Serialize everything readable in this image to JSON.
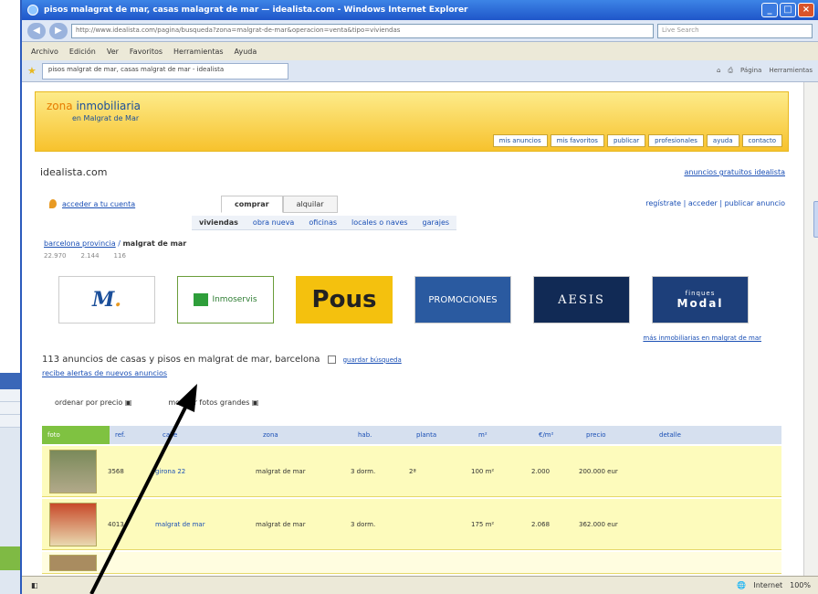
{
  "window": {
    "title": "pisos malagrat de mar, casas malagrat de mar — idealista.com - Windows Internet Explorer",
    "url": "http://www.idealista.com/pagina/busqueda?zona=malgrat-de-mar&operacion=venta&tipo=viviendas",
    "search_placeholder": "Live Search"
  },
  "menu": [
    "Archivo",
    "Edición",
    "Ver",
    "Favoritos",
    "Herramientas",
    "Ayuda"
  ],
  "tab": {
    "label": "pisos malgrat de mar, casas malgrat de mar - idealista"
  },
  "tools": [
    "Página",
    "Herramientas"
  ],
  "banner": {
    "brand_prefix": "zona",
    "brand_name": "inmobiliaria",
    "brand_sub": "en Malgrat de Mar",
    "nav": [
      "mis anuncios",
      "mis favoritos",
      "publicar",
      "profesionales",
      "ayuda",
      "contacto"
    ]
  },
  "site": {
    "name": "idealista.com",
    "top_link": "anuncios gratuitos idealista"
  },
  "user": {
    "link": "acceder a tu cuenta",
    "right_links": "regístrate | acceder | publicar anuncio"
  },
  "modes": {
    "buy": "comprar",
    "rent": "alquilar"
  },
  "subtypes": [
    "viviendas",
    "obra nueva",
    "oficinas",
    "locales o naves",
    "garajes"
  ],
  "breadcrumb": {
    "parent": "barcelona provincia",
    "current": "malgrat de mar"
  },
  "counts": [
    "22.970",
    "2.144",
    "116"
  ],
  "logos": {
    "pous": "Pous",
    "aesis": "AESIS",
    "modal": "Modal",
    "modal_top": "finques",
    "premium": "PROMOCIONES",
    "green": "Inmoservis",
    "more": "más inmobiliarias en malgrat de mar"
  },
  "results": {
    "summary": "113 anuncios de casas y pisos en malgrat de mar, barcelona",
    "save_link": "guardar búsqueda",
    "alert": "recibe alertas de nuevos anuncios",
    "order_left": "ordenar por precio",
    "order_right": "mostrar fotos grandes"
  },
  "table": {
    "headers": [
      "foto",
      "ref.",
      "calle",
      "zona",
      "hab.",
      "planta",
      "m²",
      "€/m²",
      "precio",
      "detalle"
    ],
    "rows": [
      {
        "ref": "3568",
        "calle": "girona 22",
        "zona": "malgrat de mar",
        "hab": "3 dorm.",
        "planta": "2ª",
        "m2": "100 m²",
        "eurm2": "2.000",
        "precio": "200.000 eur"
      },
      {
        "ref": "4013",
        "calle": "malgrat de mar",
        "zona": "malgrat de mar",
        "hab": "3 dorm.",
        "planta": "",
        "m2": "175 m²",
        "eurm2": "2.068",
        "precio": "362.000 eur"
      }
    ]
  },
  "status": {
    "zone": "Internet",
    "zoom": "100%"
  },
  "colors": {
    "accent_green": "#7fc241",
    "banner_yellow": "#f7c22d",
    "link_blue": "#1a4fb5"
  }
}
